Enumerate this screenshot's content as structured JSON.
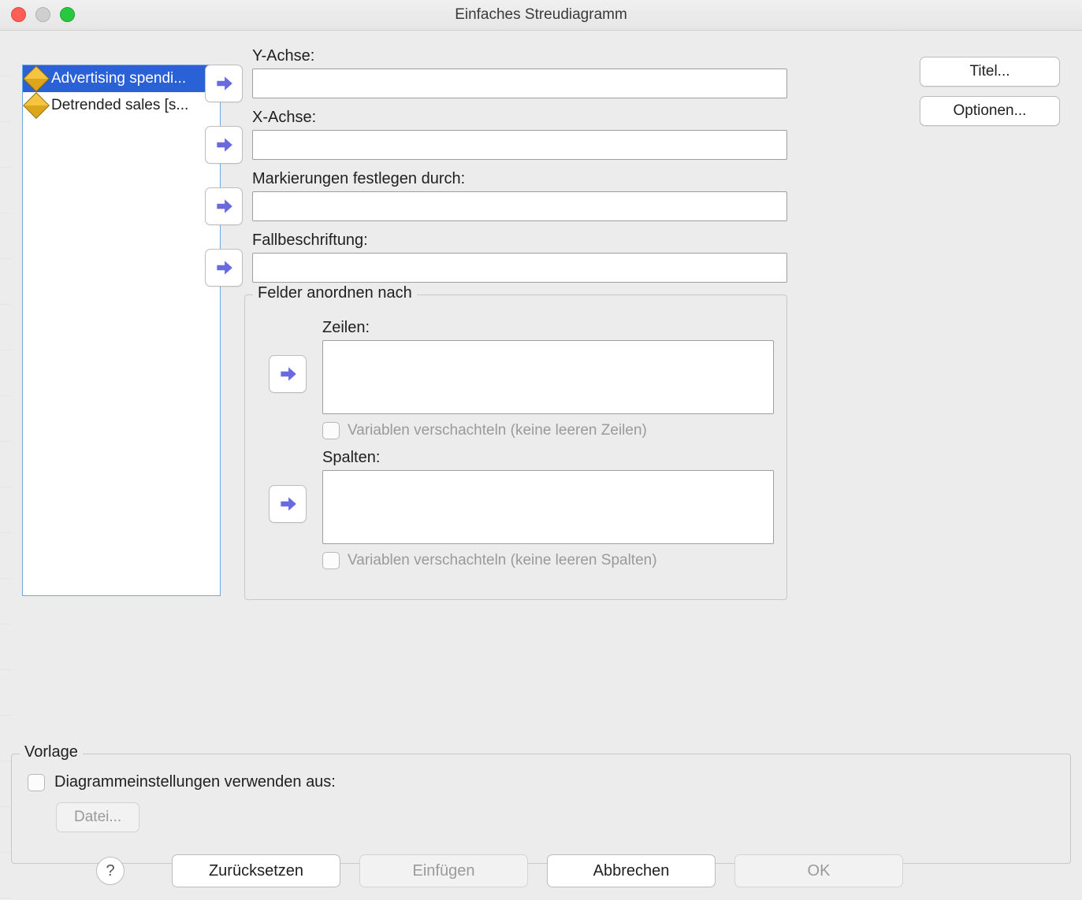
{
  "window": {
    "title": "Einfaches Streudiagramm"
  },
  "variables": [
    {
      "label": "Advertising spendi...",
      "selected": true
    },
    {
      "label": "Detrended sales [s...",
      "selected": false
    }
  ],
  "fields": {
    "y_axis": {
      "label": "Y-Achse:",
      "value": ""
    },
    "x_axis": {
      "label": "X-Achse:",
      "value": ""
    },
    "markers": {
      "label": "Markierungen festlegen durch:",
      "value": ""
    },
    "caselab": {
      "label": "Fallbeschriftung:",
      "value": ""
    }
  },
  "panel_group": {
    "title": "Felder anordnen nach",
    "rows": {
      "label": "Zeilen:",
      "value": "",
      "nest_label": "Variablen verschachteln (keine leeren Zeilen)"
    },
    "cols": {
      "label": "Spalten:",
      "value": "",
      "nest_label": "Variablen verschachteln (keine leeren Spalten)"
    }
  },
  "side_buttons": {
    "titles": "Titel...",
    "options": "Optionen..."
  },
  "template": {
    "title": "Vorlage",
    "use_settings_label": "Diagrammeinstellungen verwenden aus:",
    "file_button": "Datei..."
  },
  "bottom": {
    "help": "?",
    "reset": "Zurücksetzen",
    "paste": "Einfügen",
    "cancel": "Abbrechen",
    "ok": "OK"
  }
}
